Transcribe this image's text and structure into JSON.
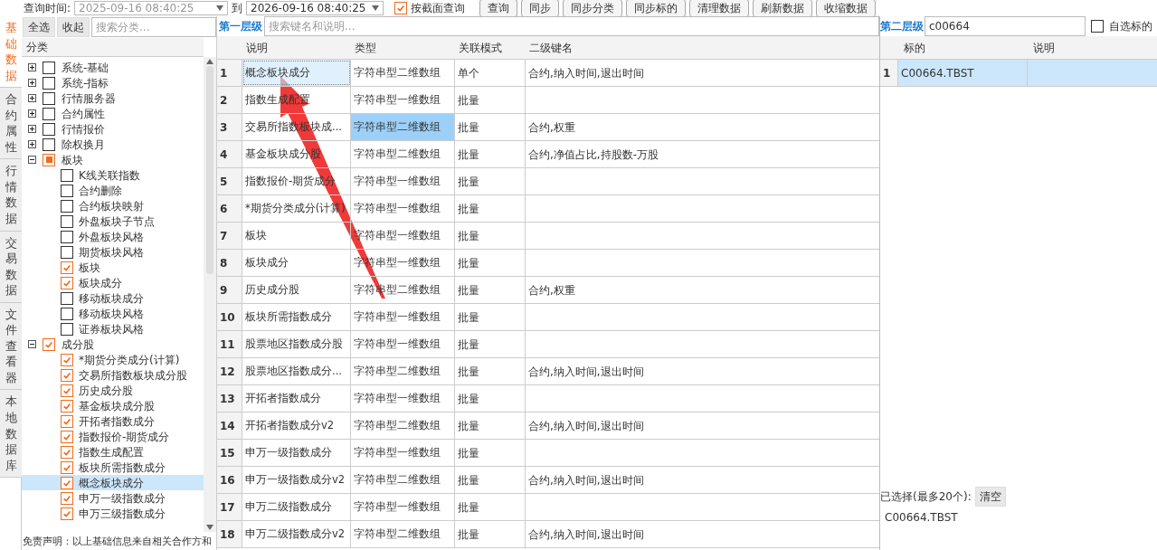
{
  "toolbar": {
    "label": "查询时间:",
    "from": "2025-09-16 08:40:25",
    "to_label": "到",
    "to": "2026-09-16 08:40:25",
    "cross_section": {
      "label": "按截面查询",
      "checked": true
    },
    "buttons": [
      "查询",
      "同步",
      "同步分类",
      "同步标的",
      "清理数据",
      "刷新数据",
      "收缩数据"
    ]
  },
  "side_tabs": [
    {
      "label": "基础数据",
      "selected": true
    },
    {
      "label": "合约属性",
      "selected": false
    },
    {
      "label": "行情数据",
      "selected": false
    },
    {
      "label": "交易数据",
      "selected": false
    },
    {
      "label": "文件查看器",
      "selected": false
    },
    {
      "label": "本地数据库",
      "selected": false
    }
  ],
  "tree_panel": {
    "buttons": [
      "全选",
      "收起"
    ],
    "search": {
      "placeholder": "搜索分类..."
    },
    "header": "分类",
    "items": [
      {
        "label": "系统-基础",
        "expanded": false,
        "checked": false,
        "partial": false
      },
      {
        "label": "系统-指标",
        "expanded": false,
        "checked": false,
        "partial": false
      },
      {
        "label": "行情服务器",
        "expanded": false,
        "checked": false,
        "partial": false
      },
      {
        "label": "合约属性",
        "expanded": false,
        "checked": false,
        "partial": false
      },
      {
        "label": "行情报价",
        "expanded": false,
        "checked": false,
        "partial": false
      },
      {
        "label": "除权换月",
        "expanded": false,
        "checked": false,
        "partial": false
      },
      {
        "label": "板块",
        "expanded": true,
        "checked": false,
        "partial": true,
        "children": [
          {
            "label": "K线关联指数",
            "checked": false,
            "selected": false
          },
          {
            "label": "合约删除",
            "checked": false,
            "selected": false
          },
          {
            "label": "合约板块映射",
            "checked": false,
            "selected": false
          },
          {
            "label": "外盘板块子节点",
            "checked": false,
            "selected": false
          },
          {
            "label": "外盘板块风格",
            "checked": false,
            "selected": false
          },
          {
            "label": "期货板块风格",
            "checked": false,
            "selected": false
          },
          {
            "label": "板块",
            "checked": true,
            "selected": false
          },
          {
            "label": "板块成分",
            "checked": true,
            "selected": false
          },
          {
            "label": "移动板块成分",
            "checked": false,
            "selected": false
          },
          {
            "label": "移动板块风格",
            "checked": false,
            "selected": false
          },
          {
            "label": "证券板块风格",
            "checked": false,
            "selected": false
          }
        ]
      },
      {
        "label": "成分股",
        "expanded": true,
        "checked": true,
        "partial": false,
        "children": [
          {
            "label": "*期货分类成分(计算)",
            "checked": true,
            "selected": false
          },
          {
            "label": "交易所指数板块成分股",
            "checked": true,
            "selected": false
          },
          {
            "label": "历史成分股",
            "checked": true,
            "selected": false
          },
          {
            "label": "基金板块成分股",
            "checked": true,
            "selected": false
          },
          {
            "label": "开拓者指数成分",
            "checked": true,
            "selected": false
          },
          {
            "label": "指数报价-期货成分",
            "checked": true,
            "selected": false
          },
          {
            "label": "指数生成配置",
            "checked": true,
            "selected": false
          },
          {
            "label": "板块所需指数成分",
            "checked": true,
            "selected": false
          },
          {
            "label": "概念板块成分",
            "checked": true,
            "selected": true
          },
          {
            "label": "申万一级指数成分",
            "checked": true,
            "selected": false
          },
          {
            "label": "申万三级指数成分",
            "checked": true,
            "selected": false
          }
        ]
      }
    ],
    "disclaimer": "免责声明：以上基础信息来自相关合作方和"
  },
  "level1": {
    "title": "第一层级",
    "search": {
      "placeholder": "搜索键名和说明..."
    },
    "columns": [
      "说明",
      "类型",
      "关联模式",
      "二级键名"
    ],
    "rows": [
      {
        "no": "1",
        "desc": "概念板块成分",
        "type": "字符串型二维数组",
        "mode": "单个",
        "keys": "合约,纳入时间,退出时间",
        "selected": true,
        "type_highlighted": false
      },
      {
        "no": "2",
        "desc": "指数生成配置",
        "type": "字符串型一维数组",
        "mode": "批量",
        "keys": "",
        "selected": false,
        "type_highlighted": false
      },
      {
        "no": "3",
        "desc": "交易所指数板块成...",
        "type": "字符串型二维数组",
        "mode": "批量",
        "keys": "合约,权重",
        "selected": false,
        "type_highlighted": true
      },
      {
        "no": "4",
        "desc": "基金板块成分股",
        "type": "字符串型二维数组",
        "mode": "批量",
        "keys": "合约,净值占比,持股数-万股",
        "selected": false,
        "type_highlighted": false
      },
      {
        "no": "5",
        "desc": "指数报价-期货成分",
        "type": "字符串型一维数组",
        "mode": "批量",
        "keys": "",
        "selected": false,
        "type_highlighted": false
      },
      {
        "no": "6",
        "desc": "*期货分类成分(计算)",
        "type": "字符串型一维数组",
        "mode": "批量",
        "keys": "",
        "selected": false,
        "type_highlighted": false
      },
      {
        "no": "7",
        "desc": "板块",
        "type": "字符串型一维数组",
        "mode": "批量",
        "keys": "",
        "selected": false,
        "type_highlighted": false
      },
      {
        "no": "8",
        "desc": "板块成分",
        "type": "字符串型一维数组",
        "mode": "批量",
        "keys": "",
        "selected": false,
        "type_highlighted": false
      },
      {
        "no": "9",
        "desc": "历史成分股",
        "type": "字符串型二维数组",
        "mode": "批量",
        "keys": "合约,权重",
        "selected": false,
        "type_highlighted": false
      },
      {
        "no": "10",
        "desc": "板块所需指数成分",
        "type": "字符串型一维数组",
        "mode": "批量",
        "keys": "",
        "selected": false,
        "type_highlighted": false
      },
      {
        "no": "11",
        "desc": "股票地区指数成分股",
        "type": "字符串型一维数组",
        "mode": "批量",
        "keys": "",
        "selected": false,
        "type_highlighted": false
      },
      {
        "no": "12",
        "desc": "股票地区指数成分...",
        "type": "字符串型二维数组",
        "mode": "批量",
        "keys": "合约,纳入时间,退出时间",
        "selected": false,
        "type_highlighted": false
      },
      {
        "no": "13",
        "desc": "开拓者指数成分",
        "type": "字符串型一维数组",
        "mode": "批量",
        "keys": "",
        "selected": false,
        "type_highlighted": false
      },
      {
        "no": "14",
        "desc": "开拓者指数成分v2",
        "type": "字符串型二维数组",
        "mode": "批量",
        "keys": "合约,纳入时间,退出时间",
        "selected": false,
        "type_highlighted": false
      },
      {
        "no": "15",
        "desc": "申万一级指数成分",
        "type": "字符串型一维数组",
        "mode": "批量",
        "keys": "",
        "selected": false,
        "type_highlighted": false
      },
      {
        "no": "16",
        "desc": "申万一级指数成分v2",
        "type": "字符串型二维数组",
        "mode": "批量",
        "keys": "合约,纳入时间,退出时间",
        "selected": false,
        "type_highlighted": false
      },
      {
        "no": "17",
        "desc": "申万二级指数成分",
        "type": "字符串型一维数组",
        "mode": "批量",
        "keys": "",
        "selected": false,
        "type_highlighted": false
      },
      {
        "no": "18",
        "desc": "申万二级指数成分v2",
        "type": "字符串型二维数组",
        "mode": "批量",
        "keys": "合约,纳入时间,退出时间",
        "selected": false,
        "type_highlighted": false
      }
    ]
  },
  "level2": {
    "title": "第二层级",
    "search": {
      "value": "c00664"
    },
    "watchlist": {
      "label": "自选标的",
      "checked": false
    },
    "columns": [
      "标的",
      "说明"
    ],
    "rows": [
      {
        "no": "1",
        "symbol": "C00664.TBST",
        "desc": "",
        "selected": true
      }
    ],
    "selected_label": "已选择(最多20个):",
    "clear_button": "清空",
    "selected_items": [
      "C00664.TBST"
    ]
  }
}
